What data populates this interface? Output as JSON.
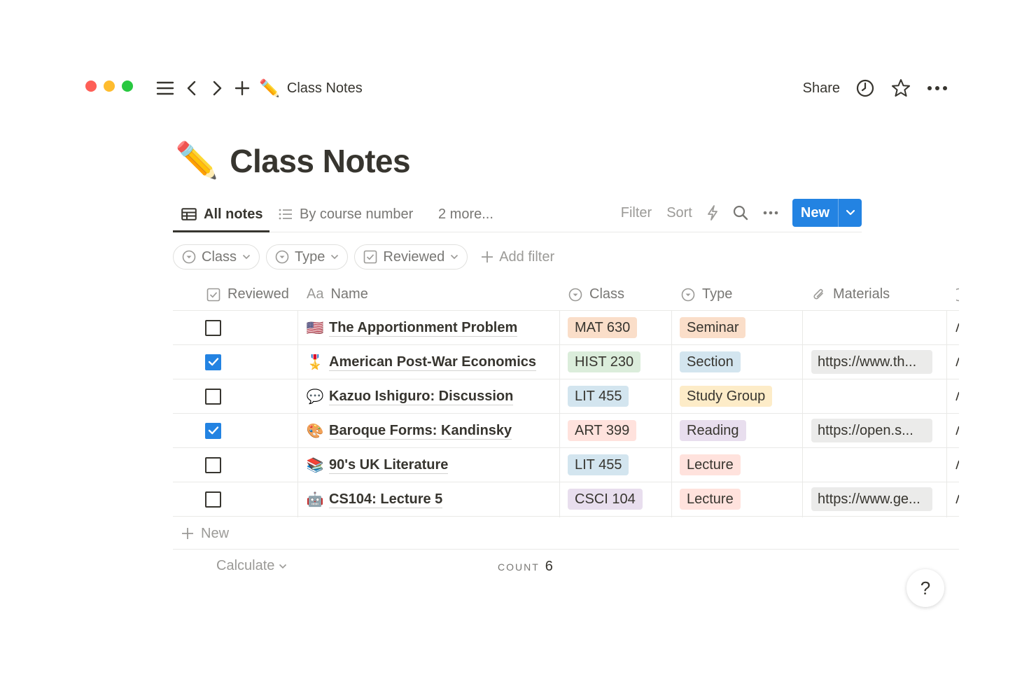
{
  "window": {
    "breadcrumb_emoji": "✏️",
    "breadcrumb_title": "Class Notes",
    "share_label": "Share"
  },
  "page": {
    "emoji": "✏️",
    "title": "Class Notes"
  },
  "views": {
    "tabs": [
      {
        "label": "All notes",
        "icon": "table-icon",
        "active": true
      },
      {
        "label": "By course number",
        "icon": "list-icon",
        "active": false
      },
      {
        "label": "2 more...",
        "icon": "",
        "active": false
      }
    ],
    "toolbar": {
      "filter_label": "Filter",
      "sort_label": "Sort",
      "new_label": "New"
    }
  },
  "filters": {
    "chips": [
      {
        "label": "Class",
        "icon": "select-icon"
      },
      {
        "label": "Type",
        "icon": "select-icon"
      },
      {
        "label": "Reviewed",
        "icon": "checkbox-icon"
      }
    ],
    "add_filter_label": "Add filter"
  },
  "table": {
    "columns": [
      {
        "label": "Reviewed",
        "icon": "checkbox-icon"
      },
      {
        "label": "Name",
        "icon": "Aa"
      },
      {
        "label": "Class",
        "icon": "select-icon"
      },
      {
        "label": "Type",
        "icon": "select-icon"
      },
      {
        "label": "Materials",
        "icon": "paperclip-icon"
      }
    ],
    "rows": [
      {
        "reviewed": false,
        "emoji": "🇺🇸",
        "name": "The Apportionment Problem",
        "class": "MAT 630",
        "class_color": "#fadec9",
        "type": "Seminar",
        "type_color": "#fadec9",
        "materials": ""
      },
      {
        "reviewed": true,
        "emoji": "🎖️",
        "name": "American Post-War Economics",
        "class": "HIST 230",
        "class_color": "#dbeddb",
        "type": "Section",
        "type_color": "#d3e5ef",
        "materials": "https://www.th..."
      },
      {
        "reviewed": false,
        "emoji": "💬",
        "name": "Kazuo Ishiguro: Discussion",
        "class": "LIT 455",
        "class_color": "#d3e5ef",
        "type": "Study Group",
        "type_color": "#fdecc8",
        "materials": ""
      },
      {
        "reviewed": true,
        "emoji": "🎨",
        "name": "Baroque Forms: Kandinsky",
        "class": "ART 399",
        "class_color": "#ffe2dd",
        "type": "Reading",
        "type_color": "#e8deee",
        "materials": "https://open.s..."
      },
      {
        "reviewed": false,
        "emoji": "📚",
        "name": "90's UK Literature",
        "class": "LIT 455",
        "class_color": "#d3e5ef",
        "type": "Lecture",
        "type_color": "#ffe2dd",
        "materials": ""
      },
      {
        "reviewed": false,
        "emoji": "🤖",
        "name": "CS104: Lecture 5",
        "class": "CSCI 104",
        "class_color": "#e8deee",
        "type": "Lecture",
        "type_color": "#ffe2dd",
        "materials": "https://www.ge..."
      }
    ],
    "new_row_label": "New"
  },
  "footer": {
    "calculate_label": "Calculate",
    "count_label": "COUNT",
    "count_value": "6"
  },
  "help_label": "?"
}
